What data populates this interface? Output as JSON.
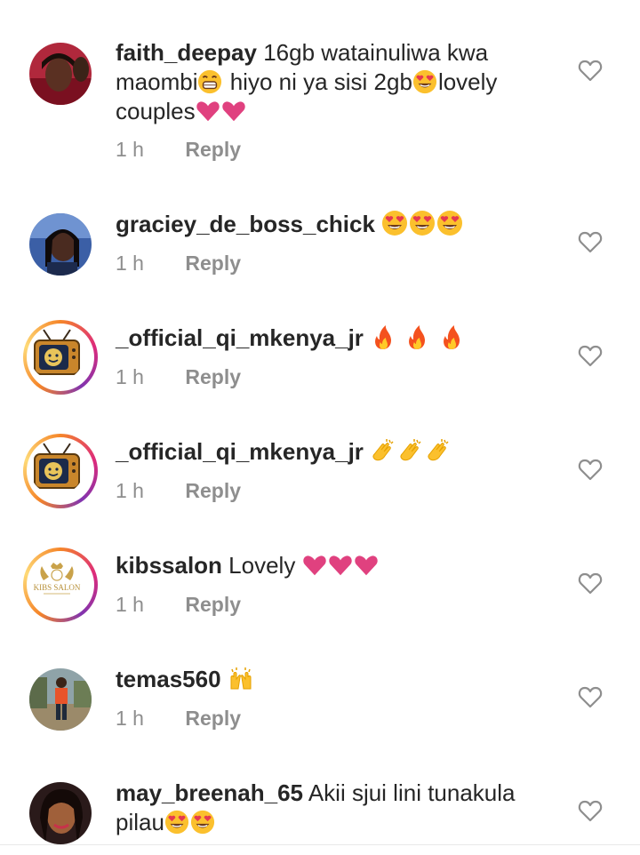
{
  "comments": [
    {
      "username": "faith_deepay",
      "text_parts": [
        "16gb watainuliwa kwa maombi",
        " hiyo ni ya sisi 2gb",
        "lovely couples"
      ],
      "emojis": [
        "grin-emoji",
        "heart-eyes-emoji",
        "pink-heart-emoji"
      ],
      "time": "1 h",
      "reply_label": "Reply"
    },
    {
      "username": "graciey_de_boss_chick",
      "text_parts": [],
      "emojis": [
        "heart-eyes-emoji",
        "heart-eyes-emoji",
        "heart-eyes-emoji"
      ],
      "time": "1 h",
      "reply_label": "Reply"
    },
    {
      "username": "_official_qi_mkenya_jr",
      "text_parts": [],
      "emojis": [
        "fire-emoji",
        "fire-emoji",
        "fire-emoji"
      ],
      "time": "1 h",
      "reply_label": "Reply"
    },
    {
      "username": "_official_qi_mkenya_jr",
      "text_parts": [],
      "emojis": [
        "clap-emoji",
        "clap-emoji",
        "clap-emoji"
      ],
      "time": "1 h",
      "reply_label": "Reply"
    },
    {
      "username": "kibssalon",
      "text_parts": [
        "Lovely"
      ],
      "emojis": [
        "pink-heart-emoji",
        "pink-heart-emoji",
        "pink-heart-emoji"
      ],
      "time": "1 h",
      "reply_label": "Reply"
    },
    {
      "username": "temas560",
      "text_parts": [],
      "emojis": [
        "raised-hands-emoji"
      ],
      "time": "1 h",
      "reply_label": "Reply"
    },
    {
      "username": "may_breenah_65",
      "text_parts": [
        "Akii sjui lini tunakula pilau"
      ],
      "emojis": [
        "heart-eyes-emoji",
        "heart-eyes-emoji"
      ],
      "time": "",
      "reply_label": ""
    }
  ],
  "avatars": {
    "kibssalon_logo_text": "KIBS SALON"
  },
  "colors": {
    "text": "#262626",
    "meta": "#8e8e8e",
    "story_ring": "#dd2a7b",
    "heart_emoji": "#e0417f"
  }
}
